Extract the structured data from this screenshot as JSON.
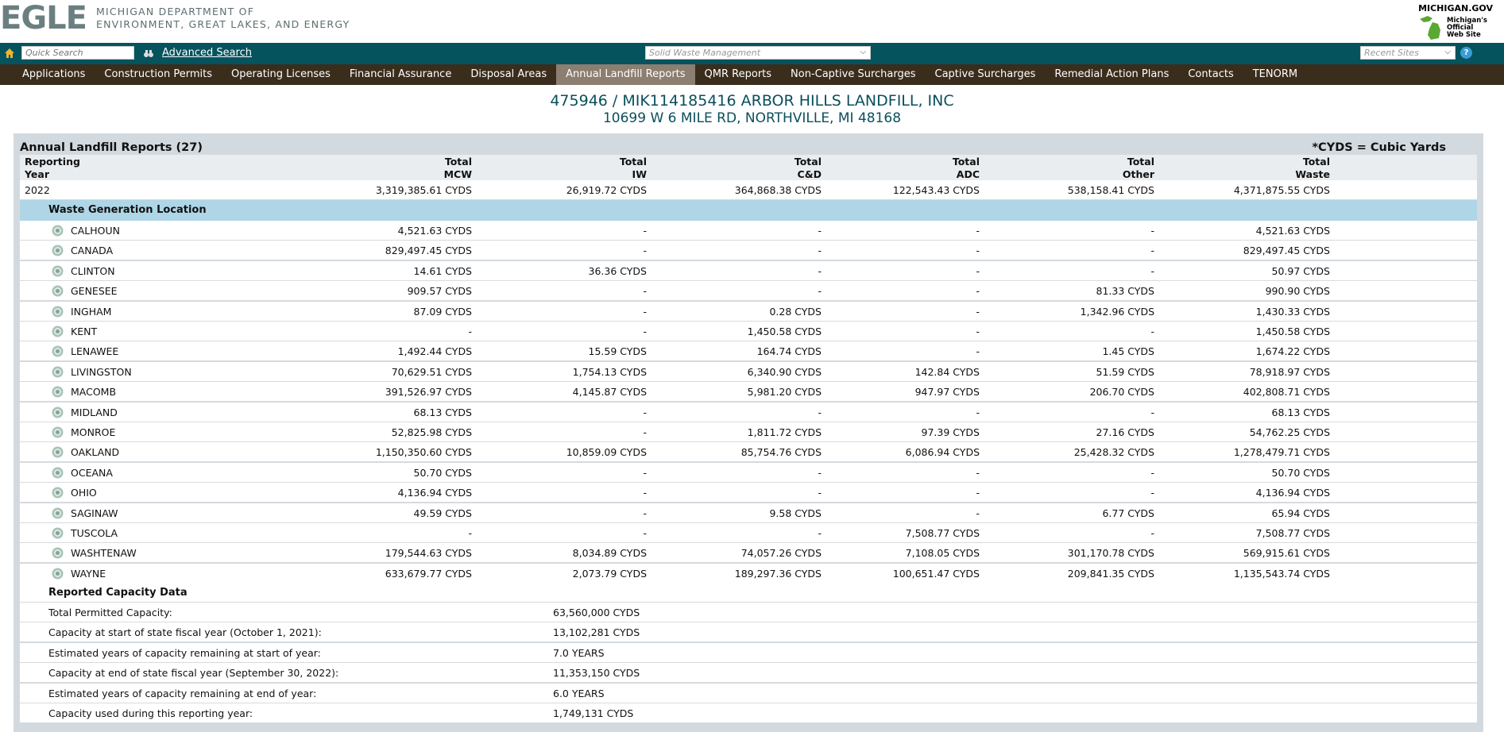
{
  "header": {
    "logo_mark": "EGLE",
    "logo_line1": "MICHIGAN DEPARTMENT OF",
    "logo_line2": "ENVIRONMENT, GREAT LAKES, AND ENERGY",
    "state_site_title": "MICHIGAN.GOV",
    "state_site_sub1": "Michigan's",
    "state_site_sub2": "Official",
    "state_site_sub3": "Web Site"
  },
  "searchbar": {
    "quick_search_placeholder": "Quick Search",
    "advanced_search_label": "Advanced Search",
    "program_select_value": "Solid Waste Management",
    "recent_sites_value": "Recent Sites",
    "help_glyph": "?"
  },
  "nav": {
    "items": [
      {
        "label": "Applications",
        "active": false
      },
      {
        "label": "Construction Permits",
        "active": false
      },
      {
        "label": "Operating Licenses",
        "active": false
      },
      {
        "label": "Financial Assurance",
        "active": false
      },
      {
        "label": "Disposal Areas",
        "active": false
      },
      {
        "label": "Annual Landfill Reports",
        "active": true
      },
      {
        "label": "QMR Reports",
        "active": false
      },
      {
        "label": "Non-Captive Surcharges",
        "active": false
      },
      {
        "label": "Captive Surcharges",
        "active": false
      },
      {
        "label": "Remedial Action Plans",
        "active": false
      },
      {
        "label": "Contacts",
        "active": false
      },
      {
        "label": "TENORM",
        "active": false
      }
    ]
  },
  "facility": {
    "title": "475946 / MIK114185416 ARBOR HILLS LANDFILL, INC",
    "address": "10699 W 6 MILE RD, NORTHVILLE, MI 48168"
  },
  "report": {
    "title": "Annual Landfill Reports (27)",
    "note": "*CYDS = Cubic Yards",
    "header_top": [
      "Reporting",
      "Total",
      "Total",
      "Total",
      "Total",
      "Total",
      "Total"
    ],
    "header_bottom": [
      "Year",
      "MCW",
      "IW",
      "C&D",
      "ADC",
      "Other",
      "Waste"
    ],
    "year_row": {
      "year": "2022",
      "values": [
        "3,319,385.61 CYDS",
        "26,919.72 CYDS",
        "364,868.38 CYDS",
        "122,543.43 CYDS",
        "538,158.41 CYDS",
        "4,371,875.55 CYDS"
      ]
    },
    "location_section_label": "Waste Generation Location",
    "counties": [
      {
        "name": "CALHOUN",
        "values": [
          "4,521.63 CYDS",
          "-",
          "-",
          "-",
          "-",
          "4,521.63 CYDS"
        ]
      },
      {
        "name": "CANADA",
        "values": [
          "829,497.45 CYDS",
          "-",
          "-",
          "-",
          "-",
          "829,497.45 CYDS"
        ]
      },
      {
        "name": "CLINTON",
        "values": [
          "14.61 CYDS",
          "36.36 CYDS",
          "-",
          "-",
          "-",
          "50.97 CYDS"
        ]
      },
      {
        "name": "GENESEE",
        "values": [
          "909.57 CYDS",
          "-",
          "-",
          "-",
          "81.33 CYDS",
          "990.90 CYDS"
        ]
      },
      {
        "name": "INGHAM",
        "values": [
          "87.09 CYDS",
          "-",
          "0.28 CYDS",
          "-",
          "1,342.96 CYDS",
          "1,430.33 CYDS"
        ]
      },
      {
        "name": "KENT",
        "values": [
          "-",
          "-",
          "1,450.58 CYDS",
          "-",
          "-",
          "1,450.58 CYDS"
        ]
      },
      {
        "name": "LENAWEE",
        "values": [
          "1,492.44 CYDS",
          "15.59 CYDS",
          "164.74 CYDS",
          "-",
          "1.45 CYDS",
          "1,674.22 CYDS"
        ]
      },
      {
        "name": "LIVINGSTON",
        "values": [
          "70,629.51 CYDS",
          "1,754.13 CYDS",
          "6,340.90 CYDS",
          "142.84 CYDS",
          "51.59 CYDS",
          "78,918.97 CYDS"
        ]
      },
      {
        "name": "MACOMB",
        "values": [
          "391,526.97 CYDS",
          "4,145.87 CYDS",
          "5,981.20 CYDS",
          "947.97 CYDS",
          "206.70 CYDS",
          "402,808.71 CYDS"
        ]
      },
      {
        "name": "MIDLAND",
        "values": [
          "68.13 CYDS",
          "-",
          "-",
          "-",
          "-",
          "68.13 CYDS"
        ]
      },
      {
        "name": "MONROE",
        "values": [
          "52,825.98 CYDS",
          "-",
          "1,811.72 CYDS",
          "97.39 CYDS",
          "27.16 CYDS",
          "54,762.25 CYDS"
        ]
      },
      {
        "name": "OAKLAND",
        "values": [
          "1,150,350.60 CYDS",
          "10,859.09 CYDS",
          "85,754.76 CYDS",
          "6,086.94 CYDS",
          "25,428.32 CYDS",
          "1,278,479.71 CYDS"
        ]
      },
      {
        "name": "OCEANA",
        "values": [
          "50.70 CYDS",
          "-",
          "-",
          "-",
          "-",
          "50.70 CYDS"
        ]
      },
      {
        "name": "OHIO",
        "values": [
          "4,136.94 CYDS",
          "-",
          "-",
          "-",
          "-",
          "4,136.94 CYDS"
        ]
      },
      {
        "name": "SAGINAW",
        "values": [
          "49.59 CYDS",
          "-",
          "9.58 CYDS",
          "-",
          "6.77 CYDS",
          "65.94 CYDS"
        ]
      },
      {
        "name": "TUSCOLA",
        "values": [
          "-",
          "-",
          "-",
          "7,508.77 CYDS",
          "-",
          "7,508.77 CYDS"
        ]
      },
      {
        "name": "WASHTENAW",
        "values": [
          "179,544.63 CYDS",
          "8,034.89 CYDS",
          "74,057.26 CYDS",
          "7,108.05 CYDS",
          "301,170.78 CYDS",
          "569,915.61 CYDS"
        ]
      },
      {
        "name": "WAYNE",
        "values": [
          "633,679.77 CYDS",
          "2,073.79 CYDS",
          "189,297.36 CYDS",
          "100,651.47 CYDS",
          "209,841.35 CYDS",
          "1,135,543.74 CYDS"
        ]
      }
    ],
    "capacity_section_label": "Reported Capacity Data",
    "capacity": [
      {
        "label": "Total Permitted Capacity:",
        "value": "63,560,000 CYDS"
      },
      {
        "label": "Capacity at start of state fiscal year (October 1, 2021):",
        "value": "13,102,281 CYDS"
      },
      {
        "label": "Estimated years of capacity remaining at start of year:",
        "value": "7.0 YEARS"
      },
      {
        "label": "Capacity at end of state fiscal year (September 30, 2022):",
        "value": "11,353,150 CYDS"
      },
      {
        "label": "Estimated years of capacity remaining at end of year:",
        "value": "6.0 YEARS"
      },
      {
        "label": "Capacity used during this reporting year:",
        "value": "1,749,131 CYDS"
      }
    ]
  },
  "colors": {
    "search_bar": "#04535d",
    "nav_bar": "#3b2d1c",
    "nav_active": "#8c7e70",
    "section_band": "#aed6e7",
    "title_text": "#0a4f5c"
  }
}
